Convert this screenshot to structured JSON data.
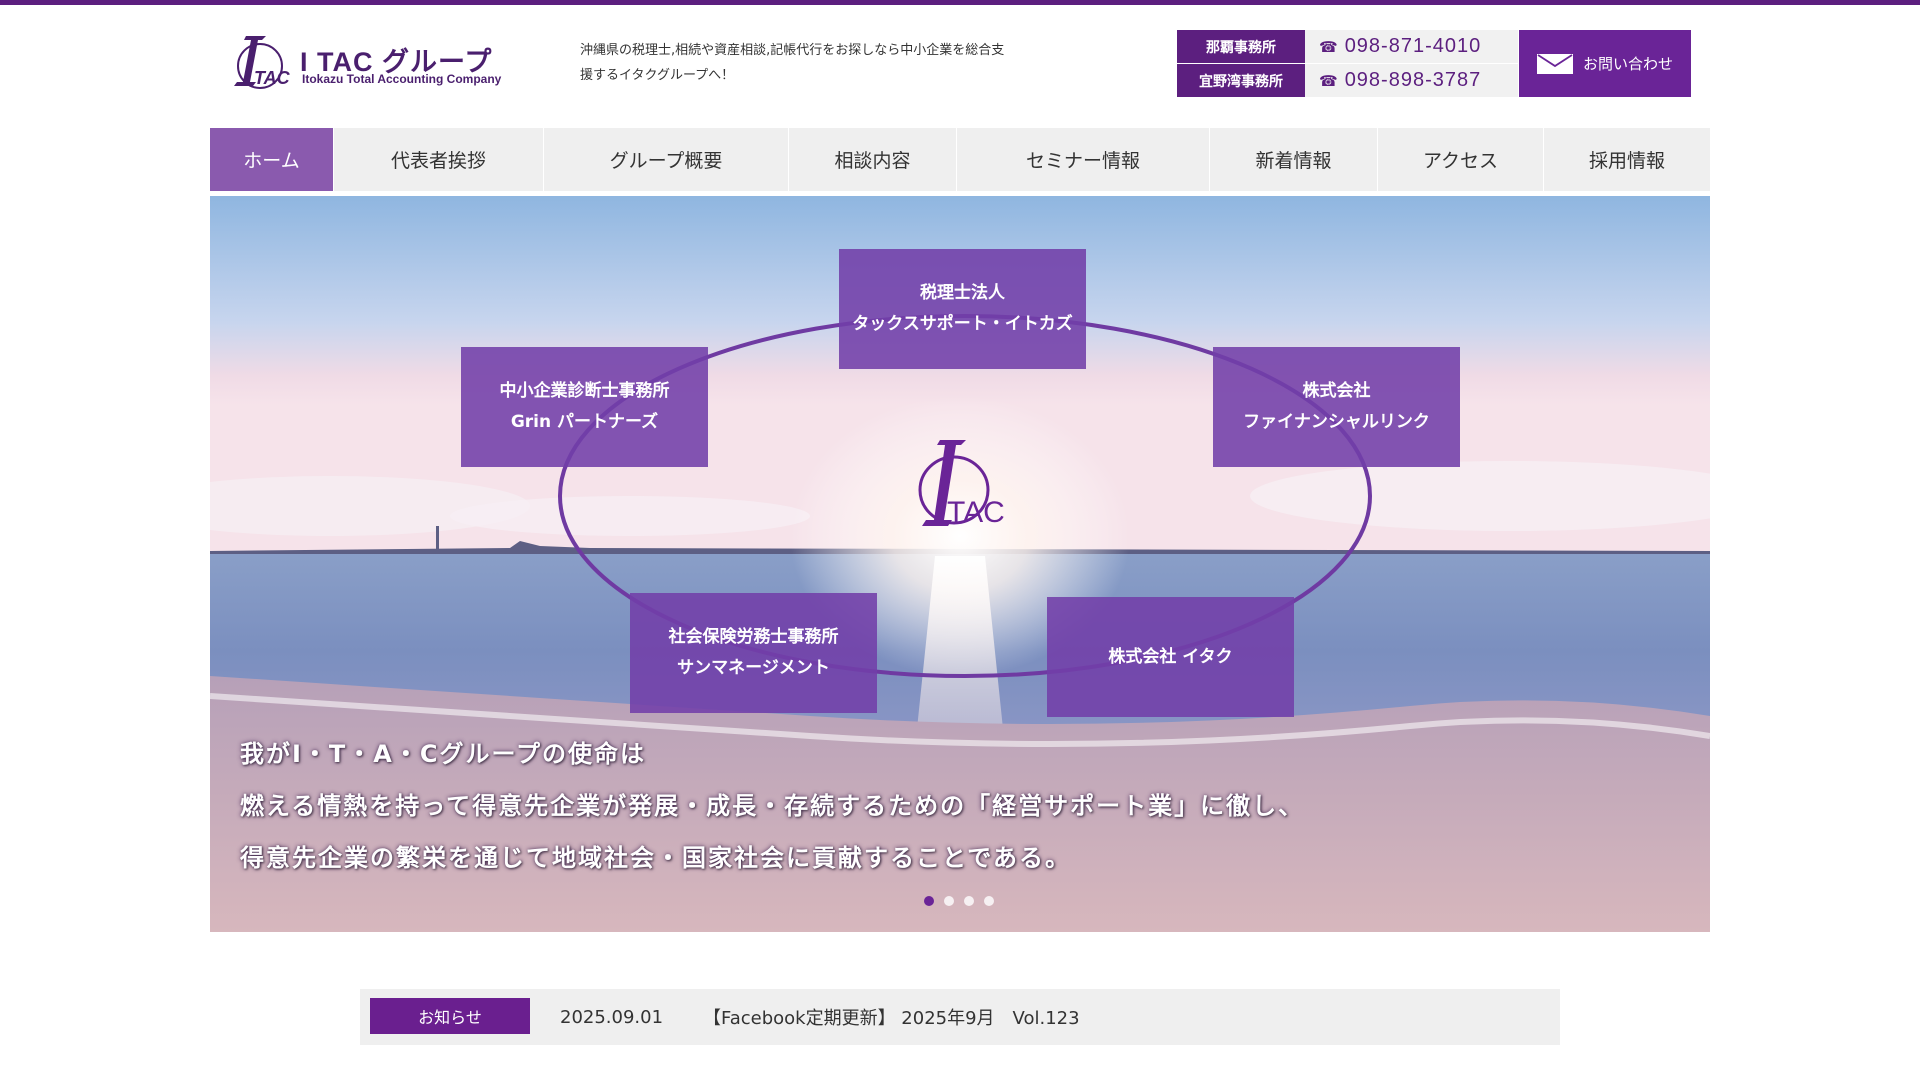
{
  "header": {
    "logo_title": "I TAC グループ",
    "logo_subtitle": "Itokazu Total Accounting Company",
    "logo_mark_text": "TAC",
    "tagline": "沖縄県の税理士,相続や資産相談,記帳代行をお探しなら中小企業を総合支援するイタクグループへ！",
    "offices": [
      {
        "name": "那覇事務所",
        "phone": "098-871-4010"
      },
      {
        "name": "宜野湾事務所",
        "phone": "098-898-3787"
      }
    ],
    "contact_label": "お問い合わせ"
  },
  "nav": {
    "items": [
      {
        "label": "ホーム"
      },
      {
        "label": "代表者挨拶"
      },
      {
        "label": "グループ概要"
      },
      {
        "label": "相談内容"
      },
      {
        "label": "セミナー情報"
      },
      {
        "label": "新着情報"
      },
      {
        "label": "アクセス"
      },
      {
        "label": "採用情報"
      }
    ]
  },
  "hero": {
    "logo_text": "TAC",
    "orgs": [
      {
        "line1": "税理士法人",
        "line2": "タックスサポート・イトカズ"
      },
      {
        "line1": "株式会社",
        "line2": "ファイナンシャルリンク"
      },
      {
        "line1": "株式会社 イタク",
        "line2": ""
      },
      {
        "line1": "社会保険労務士事務所",
        "line2": "サンマネージメント"
      },
      {
        "line1": "中小企業診断士事務所",
        "line2": "Grin パートナーズ"
      }
    ],
    "mission": [
      "我がI・T・A・Cグループの使命は",
      "燃える情熱を持って得意先企業が発展・成長・存続するための「経営サポート業」に徹し、",
      "得意先企業の繁栄を通じて地域社会・国家社会に貢献することである。"
    ],
    "slides_total": 4,
    "slide_current": 1
  },
  "news": {
    "label": "お知らせ",
    "date": "2025.09.01",
    "title": "【Facebook定期更新】 2025年9月　Vol.123"
  },
  "colors": {
    "brand": "#5c1f7f",
    "accent": "#6a2497",
    "nav_active": "#8a5aae",
    "org_box": "#723fa8"
  },
  "icons": {
    "phone": "phone-icon",
    "mail": "mail-icon"
  }
}
